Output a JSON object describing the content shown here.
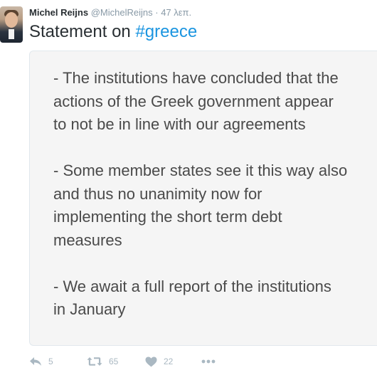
{
  "tweet": {
    "author_name": "Michel Reijns",
    "handle": "@MichelReijns",
    "separator": "·",
    "time": "47 λεπ.",
    "title_text": "Statement on",
    "hashtag": "#greece",
    "image_paragraphs": [
      "- The institutions have concluded that the\nactions of the Greek government appear\nto not be in line with our agreements",
      "- Some member states see it this way also\nand thus no unanimity now for\nimplementing the short term debt\nmeasures",
      "- We await a full report of the institutions\nin January"
    ],
    "actions": {
      "reply_icon": "reply-icon",
      "reply_count": "5",
      "retweet_icon": "retweet-icon",
      "retweet_count": "65",
      "like_icon": "heart-icon",
      "like_count": "22",
      "more_icon": "more-icon"
    }
  },
  "colors": {
    "text": "#292f33",
    "muted": "#8899a6",
    "hashtag": "#1b95e0",
    "icon": "#aab8c2",
    "image_bg": "#f5f5f5"
  }
}
